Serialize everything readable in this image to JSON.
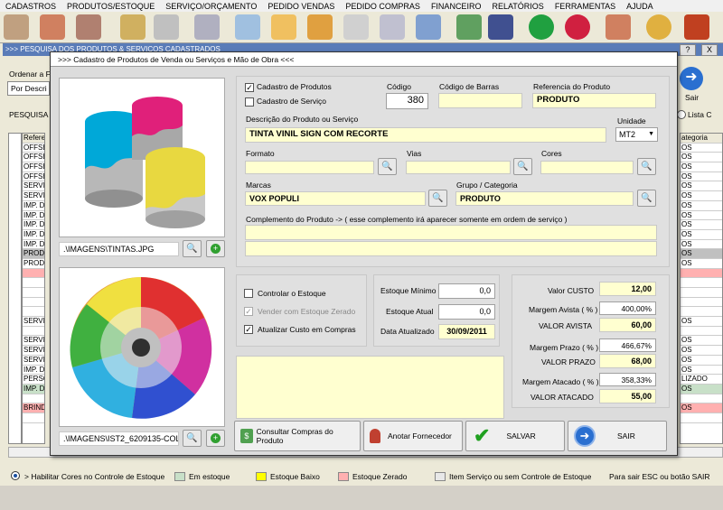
{
  "menu": [
    "CADASTROS",
    "PRODUTOS/ESTOQUE",
    "SERVIÇO/ORÇAMENTO",
    "PEDIDO VENDAS",
    "PEDIDO COMPRAS",
    "FINANCEIRO",
    "RELATÓRIOS",
    "FERRAMENTAS",
    "AJUDA"
  ],
  "bg": {
    "window_title": ">>> PESQUISA DOS PRODUTOS & SERVIÇOS CADASTRADOS",
    "ordenar_label": "Ordenar a F",
    "ordenar_value": "Por Descri",
    "pesquisa_label": "PESQUISA",
    "col_header": "Referen",
    "col_header_right": "ategoria",
    "lista_label": "Lista C",
    "sair_label": "Sair",
    "help": "?",
    "close": "X",
    "rows": [
      "OFFSE",
      "OFFSE",
      "OFFSE",
      "OFFSE",
      "SERVI",
      "SERVI",
      "IMP. D",
      "IMP. D",
      "IMP. D",
      "IMP. D",
      "IMP. D",
      "PRODU",
      "PRODU",
      "",
      "",
      "",
      "",
      "",
      "SERVIC",
      "",
      "SERVI",
      "SERVI",
      "SERVI",
      "IMP. D",
      "PERSO",
      "IMP. D",
      "",
      "BRIND",
      ""
    ],
    "rows_right": [
      "OS",
      "OS",
      "OS",
      "OS",
      "OS",
      "OS",
      "OS",
      "OS",
      "OS",
      "OS",
      "OS",
      "OS",
      "OS",
      "",
      "",
      "",
      "",
      "",
      "OS",
      "",
      "OS",
      "OS",
      "OS",
      "OS",
      "LIZADO",
      "OS",
      "",
      "OS",
      ""
    ]
  },
  "modal": {
    "title": ">>>  Cadastro de Produtos de Venda ou Serviços e Mão de Obra  <<<",
    "image1_path": ".\\IMAGENS\\TINTAS.JPG",
    "image2_path": ".\\IMAGENS\\IST2_6209135-COLOI",
    "cadastro_produtos": "Cadastro de Produtos",
    "cadastro_servico": "Cadastro de Serviço",
    "codigo_label": "Código",
    "codigo_value": "380",
    "barras_label": "Código de Barras",
    "barras_value": "",
    "referencia_label": "Referencia do Produto",
    "referencia_value": "PRODUTO",
    "descricao_label": "Descrição do Produto ou Serviço",
    "descricao_value": "TINTA VINIL SIGN COM RECORTE",
    "unidade_label": "Unidade",
    "unidade_value": "MT2",
    "formato_label": "Formato",
    "vias_label": "Vias",
    "cores_label": "Cores",
    "marcas_label": "Marcas",
    "marcas_value": "VOX POPULI",
    "grupo_label": "Grupo / Categoria",
    "grupo_value": "PRODUTO",
    "complemento_label": "Complemento do Produto   ->   ( esse complemento irá aparecer somente em ordem de serviço )",
    "controlar_estoque": "Controlar o Estoque",
    "vender_zerado": "Vender com Estoque Zerado",
    "atualizar_custo": "Atualizar Custo em Compras",
    "estoque_minimo_label": "Estoque Mínimo",
    "estoque_minimo_value": "0,0",
    "estoque_atual_label": "Estoque Atual",
    "estoque_atual_value": "0,0",
    "data_label": "Data Atualizado",
    "data_value": "30/09/2011",
    "valor_custo_label": "Valor CUSTO",
    "valor_custo_value": "12,00",
    "margem_avista_label": "Margem Avista ( % )",
    "margem_avista_value": "400,00%",
    "valor_avista_label": "VALOR AVISTA",
    "valor_avista_value": "60,00",
    "margem_prazo_label": "Margem Prazo ( % )",
    "margem_prazo_value": "466,67%",
    "valor_prazo_label": "VALOR PRAZO",
    "valor_prazo_value": "68,00",
    "margem_atacado_label": "Margem Atacado ( % )",
    "margem_atacado_value": "358,33%",
    "valor_atacado_label": "VALOR ATACADO",
    "valor_atacado_value": "55,00",
    "btn_consultar": "Consultar Compras do Produto",
    "btn_anotar": "Anotar Fornecedor",
    "btn_salvar": "SALVAR",
    "btn_sair": "SAIR"
  },
  "status": {
    "habilitar": "> Habilitar Cores no Controle de Estoque",
    "em_estoque": "Em estoque",
    "baixo": "Estoque Baixo",
    "zerado": "Estoque Zerado",
    "item_servico": "Item Serviço ou sem Controle de Estoque",
    "sair_hint": "Para sair ESC ou botão SAIR"
  },
  "colors": {
    "field_yellow": "#ffffd0",
    "em_estoque": "#c8e0c8",
    "baixo": "#ffff00",
    "zerado": "#ffb0b0",
    "item_servico": "#e8e8e8"
  }
}
